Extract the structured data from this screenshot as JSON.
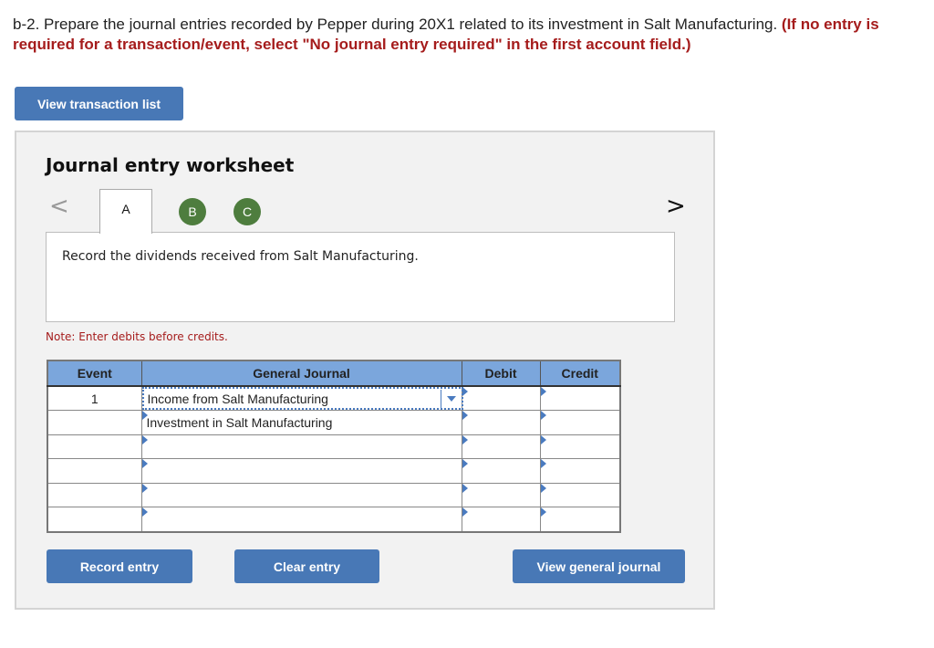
{
  "question": {
    "text": "b-2. Prepare the journal entries recorded by Pepper during 20X1 related to its investment in Salt Manufacturing. ",
    "hint": "(If no entry is required for a transaction/event, select \"No journal entry required\" in the first account field.)"
  },
  "buttons": {
    "view_transaction_list": "View transaction list",
    "record_entry": "Record entry",
    "clear_entry": "Clear entry",
    "view_general_journal": "View general journal"
  },
  "worksheet": {
    "title": "Journal entry worksheet",
    "nav_prev": "<",
    "nav_next": ">",
    "tabs": [
      {
        "label": "A",
        "state": "active"
      },
      {
        "label": "B",
        "state": "completed"
      },
      {
        "label": "C",
        "state": "completed"
      }
    ],
    "prompt": "Record the dividends received from Salt Manufacturing.",
    "note": "Note: Enter debits before credits."
  },
  "journal": {
    "headers": [
      "Event",
      "General Journal",
      "Debit",
      "Credit"
    ],
    "rows": [
      {
        "event": "1",
        "account": "Income from Salt Manufacturing",
        "debit": "",
        "credit": ""
      },
      {
        "event": "",
        "account": "Investment in Salt Manufacturing",
        "debit": "",
        "credit": ""
      },
      {
        "event": "",
        "account": "",
        "debit": "",
        "credit": ""
      },
      {
        "event": "",
        "account": "",
        "debit": "",
        "credit": ""
      },
      {
        "event": "",
        "account": "",
        "debit": "",
        "credit": ""
      },
      {
        "event": "",
        "account": "",
        "debit": "",
        "credit": ""
      }
    ]
  },
  "colors": {
    "button_blue": "#4878b6",
    "header_blue": "#7ba6dc",
    "tab_green": "#4e7d3e",
    "hint_red": "#a51c1c"
  }
}
